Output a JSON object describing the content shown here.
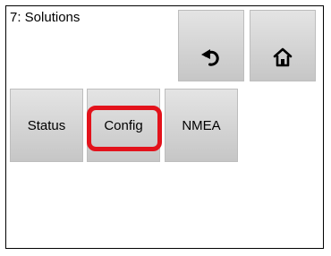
{
  "header": {
    "title": "7: Solutions"
  },
  "toolbar": {
    "back_icon": "undo-arrow-icon",
    "home_icon": "home-icon"
  },
  "menu": {
    "items": [
      {
        "label": "Status"
      },
      {
        "label": "Config"
      },
      {
        "label": "NMEA"
      }
    ],
    "highlighted": "Config",
    "highlight_color": "#e3121b"
  }
}
